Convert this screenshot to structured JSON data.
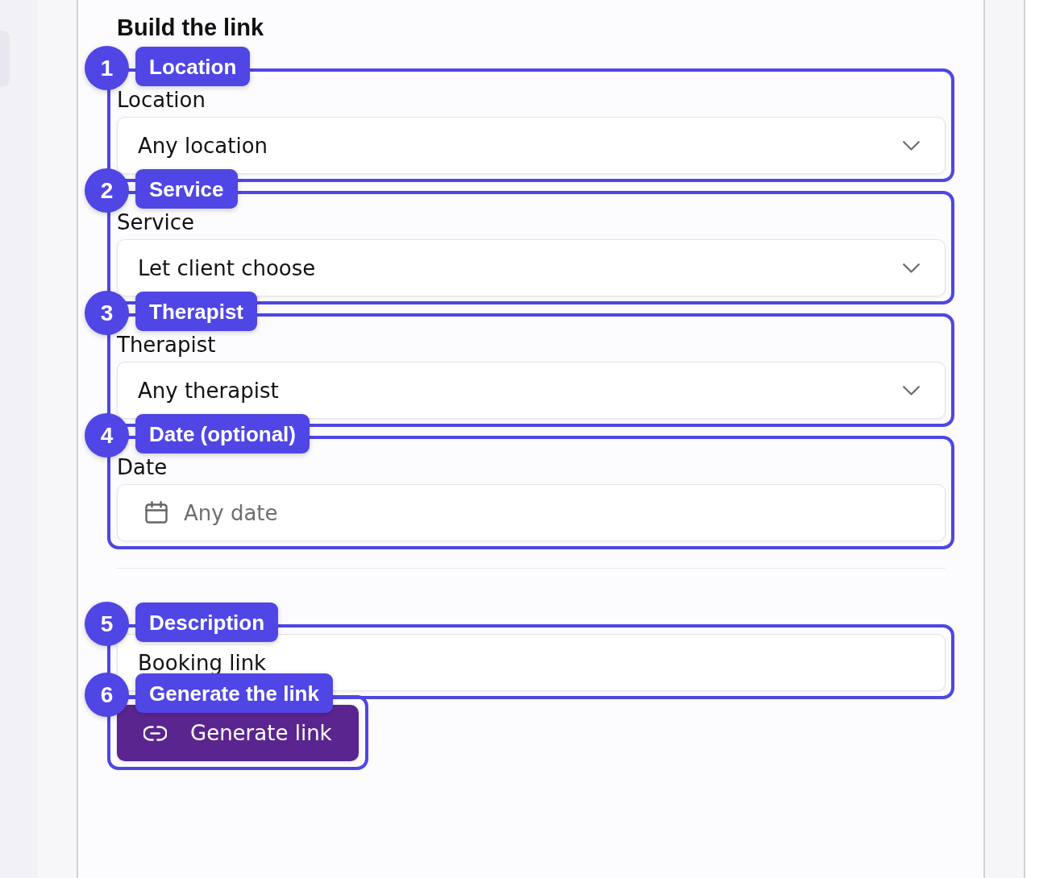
{
  "heading": "Build the link",
  "fields": [
    {
      "kind": "select",
      "label": "Location",
      "value": "Any location"
    },
    {
      "kind": "select",
      "label": "Service",
      "value": "Let client choose"
    },
    {
      "kind": "select",
      "label": "Therapist",
      "value": "Any therapist"
    },
    {
      "kind": "date",
      "label": "Date",
      "placeholder": "Any date"
    }
  ],
  "description_field": {
    "value": "Booking link"
  },
  "generate_button": {
    "label": "Generate link"
  },
  "annotations": [
    {
      "number": "1",
      "label": "Location"
    },
    {
      "number": "2",
      "label": "Service"
    },
    {
      "number": "3",
      "label": "Therapist"
    },
    {
      "number": "4",
      "label": "Date (optional)"
    },
    {
      "number": "5",
      "label": "Description"
    },
    {
      "number": "6",
      "label": "Generate the link"
    }
  ]
}
